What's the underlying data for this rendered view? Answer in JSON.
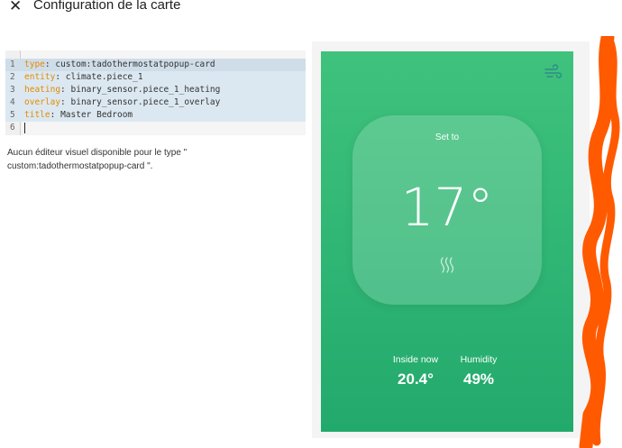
{
  "header": {
    "close_icon": "close-icon",
    "title": "Configuration de la carte"
  },
  "editor": {
    "lines": [
      {
        "num": "1",
        "key": "type",
        "value": " custom:tadothermostatpopup-card"
      },
      {
        "num": "2",
        "key": "entity",
        "value": " climate.piece_1"
      },
      {
        "num": "3",
        "key": "heating",
        "value": " binary_sensor.piece_1_heating"
      },
      {
        "num": "4",
        "key": "overlay",
        "value": " binary_sensor.piece_1_overlay"
      },
      {
        "num": "5",
        "key": "title",
        "value": " Master Bedroom"
      },
      {
        "num": "6",
        "key": "",
        "value": ""
      }
    ]
  },
  "message": {
    "line1": "Aucun éditeur visuel disponible pour le type \"",
    "line2": "custom:tadothermostatpopup-card \"."
  },
  "preview": {
    "wind_icon": "wind-icon",
    "set_to_label": "Set to",
    "set_temp": "17°",
    "heating_icon": "heating-waves-icon",
    "inside_label": "Inside now",
    "inside_value": "20.4°",
    "humidity_label": "Humidity",
    "humidity_value": "49%",
    "colors": {
      "card_top": "#3fc27c",
      "card_bottom": "#22a96c",
      "annotation_scribble": "#ff5a00"
    }
  }
}
